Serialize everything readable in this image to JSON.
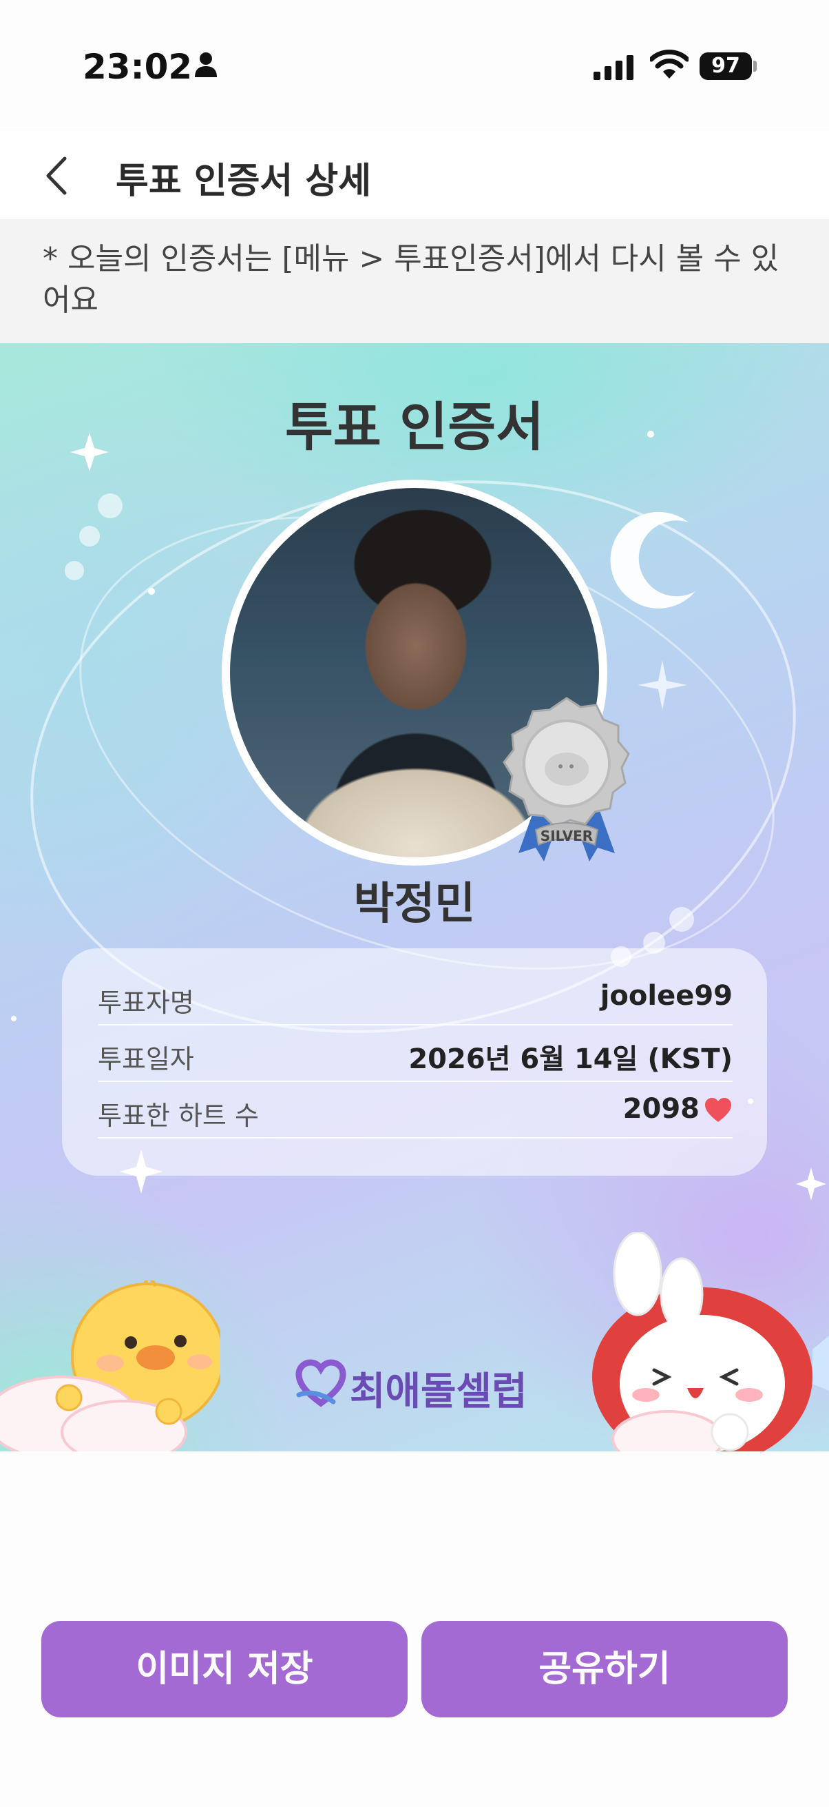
{
  "status_bar": {
    "time": "23:02",
    "battery": "97",
    "icons": [
      "person-icon",
      "signal-icon",
      "wifi-icon",
      "battery-icon"
    ]
  },
  "header": {
    "title": "투표 인증서 상세",
    "back_icon": "chevron-left-icon"
  },
  "notice": {
    "text": "* 오늘의 인증서는 [메뉴 > 투표인증서]에서 다시 볼 수 있어요"
  },
  "certificate": {
    "title": "투표 인증서",
    "artist_name": "박정민",
    "badge_label": "SILVER",
    "rows": [
      {
        "label": "투표자명",
        "value": "joolee99"
      },
      {
        "label": "투표일자",
        "value": "2026년 6월 14일 (KST)"
      },
      {
        "label": "투표한 하트 수",
        "value": "2098"
      }
    ],
    "brand": "최애돌셀럽",
    "colors": {
      "brand": "#6a4bb4",
      "heart": "#f0505a"
    }
  },
  "actions": {
    "save_label": "이미지 저장",
    "share_label": "공유하기",
    "button_color": "#a46ad4"
  }
}
